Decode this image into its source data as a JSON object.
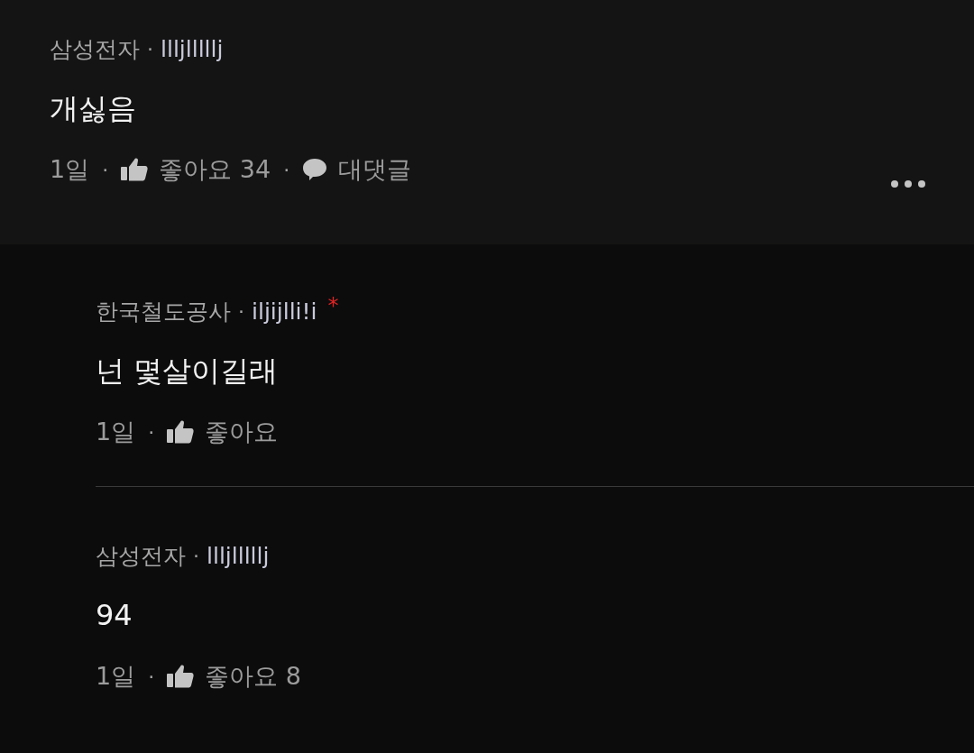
{
  "comment": {
    "author": "삼성전자",
    "separator": "·",
    "nickname": "llljlllllj",
    "text": "개싫음",
    "meta": [
      {
        "kind": "time",
        "label": "1일"
      },
      {
        "kind": "separator",
        "label": "·"
      },
      {
        "kind": "like",
        "label": "좋아요 34"
      },
      {
        "kind": "separator",
        "label": "·"
      },
      {
        "kind": "reply",
        "label": "대댓글"
      }
    ]
  },
  "replies": [
    {
      "author": "한국철도공사",
      "separator": "·",
      "nickname": "iljijlli!i",
      "mark": "*",
      "text": "넌 몇살이길래",
      "meta": [
        {
          "kind": "time",
          "label": "1일"
        },
        {
          "kind": "separator",
          "label": "·"
        },
        {
          "kind": "like",
          "label": "좋아요"
        }
      ]
    },
    {
      "author": "삼성전자",
      "separator": "·",
      "nickname": "llljlllllj",
      "text": "94",
      "meta": [
        {
          "kind": "time",
          "label": "1일"
        },
        {
          "kind": "separator",
          "label": "·"
        },
        {
          "kind": "like",
          "label": "좋아요 8"
        }
      ]
    }
  ]
}
